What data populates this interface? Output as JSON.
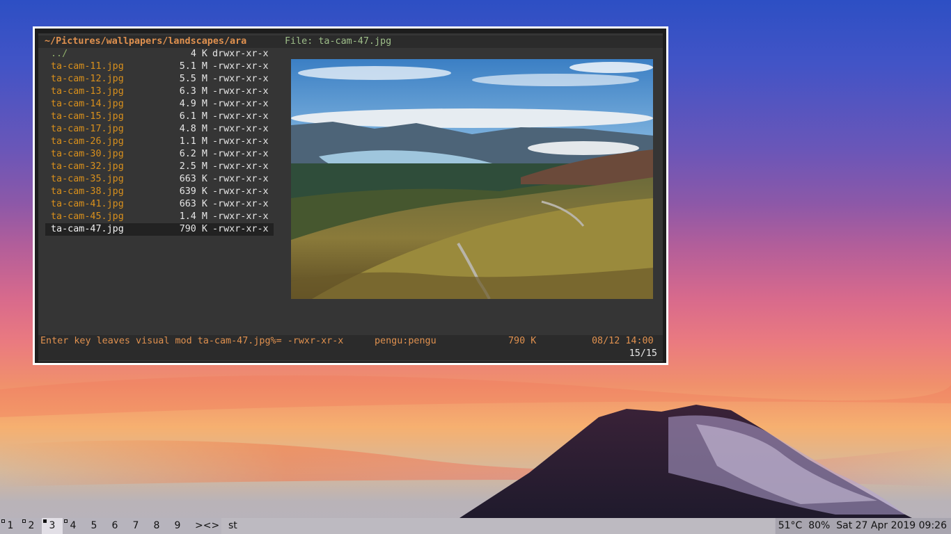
{
  "terminal": {
    "path": "~/Pictures/wallpapers/landscapes/ara",
    "file_label": "File: ta-cam-47.jpg",
    "files": [
      {
        "name": "../",
        "size": "4 K",
        "perm": "drwxr-xr-x",
        "kind": "parent"
      },
      {
        "name": "ta-cam-11.jpg",
        "size": "5.1 M",
        "perm": "-rwxr-xr-x"
      },
      {
        "name": "ta-cam-12.jpg",
        "size": "5.5 M",
        "perm": "-rwxr-xr-x"
      },
      {
        "name": "ta-cam-13.jpg",
        "size": "6.3 M",
        "perm": "-rwxr-xr-x"
      },
      {
        "name": "ta-cam-14.jpg",
        "size": "4.9 M",
        "perm": "-rwxr-xr-x"
      },
      {
        "name": "ta-cam-15.jpg",
        "size": "6.1 M",
        "perm": "-rwxr-xr-x"
      },
      {
        "name": "ta-cam-17.jpg",
        "size": "4.8 M",
        "perm": "-rwxr-xr-x"
      },
      {
        "name": "ta-cam-26.jpg",
        "size": "1.1 M",
        "perm": "-rwxr-xr-x"
      },
      {
        "name": "ta-cam-30.jpg",
        "size": "6.2 M",
        "perm": "-rwxr-xr-x"
      },
      {
        "name": "ta-cam-32.jpg",
        "size": "2.5 M",
        "perm": "-rwxr-xr-x"
      },
      {
        "name": "ta-cam-35.jpg",
        "size": "663 K",
        "perm": "-rwxr-xr-x"
      },
      {
        "name": "ta-cam-38.jpg",
        "size": "639 K",
        "perm": "-rwxr-xr-x"
      },
      {
        "name": "ta-cam-41.jpg",
        "size": "663 K",
        "perm": "-rwxr-xr-x"
      },
      {
        "name": "ta-cam-45.jpg",
        "size": "1.4 M",
        "perm": "-rwxr-xr-x"
      },
      {
        "name": "ta-cam-47.jpg",
        "size": "790 K",
        "perm": "-rwxr-xr-x",
        "kind": "selected"
      }
    ],
    "status": {
      "message": "Enter key leaves visual mod ta-cam-47.jpg%= -rwxr-xr-x",
      "owner": "pengu:pengu",
      "size": "790 K",
      "date": "08/12 14:00"
    },
    "position": "15/15"
  },
  "taskbar": {
    "tags": [
      {
        "label": "1",
        "dot": "outline"
      },
      {
        "label": "2",
        "dot": "outline"
      },
      {
        "label": "3",
        "dot": "filled",
        "active": true
      },
      {
        "label": "4",
        "dot": "outline"
      },
      {
        "label": "5"
      },
      {
        "label": "6"
      },
      {
        "label": "7"
      },
      {
        "label": "8"
      },
      {
        "label": "9"
      }
    ],
    "layout_symbol": "><>",
    "window_title": "st",
    "temperature": "51°C",
    "battery": "80%",
    "datetime": "Sat 27 Apr 2019 09:26"
  }
}
